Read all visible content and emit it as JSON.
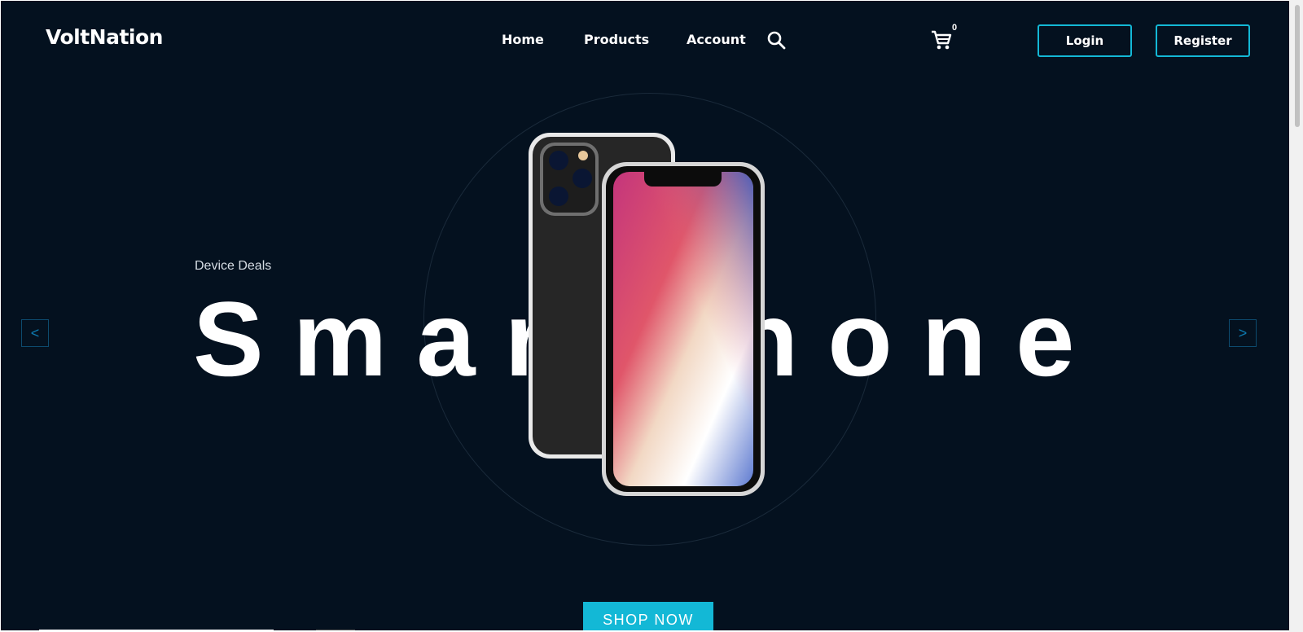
{
  "brand": {
    "name": "VoltNation"
  },
  "nav": {
    "home": "Home",
    "products": "Products",
    "account": "Account",
    "search_icon": "search-icon",
    "cart_icon": "cart-icon",
    "cart_count": "0"
  },
  "auth": {
    "login": "Login",
    "register": "Register"
  },
  "hero": {
    "eyebrow": "Device Deals",
    "headline": "Smartphone",
    "cta": "SHOP NOW",
    "prev": "<",
    "next": ">"
  },
  "colors": {
    "background": "#04111f",
    "accent": "#13b8d6"
  }
}
